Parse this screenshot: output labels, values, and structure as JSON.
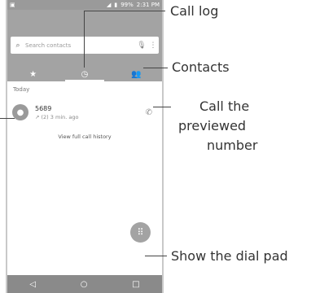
{
  "status": {
    "left_icon": "sim-icon",
    "battery": "99%",
    "time": "2:31 PM"
  },
  "search": {
    "placeholder": "Search contacts"
  },
  "tabs": [
    {
      "name": "tab-favorites",
      "glyph": "★"
    },
    {
      "name": "tab-call-log",
      "glyph": "◷"
    },
    {
      "name": "tab-contacts",
      "glyph": "👥"
    }
  ],
  "section_header": "Today",
  "call": {
    "number": "5689",
    "detail": "(2) 3 min. ago"
  },
  "full_history": "View full call history",
  "annotations": {
    "call_log": "Call log",
    "contacts": "Contacts",
    "call_previewed_1": "Call the",
    "call_previewed_2": "previewed",
    "call_previewed_3": "number",
    "dial_pad": "Show the dial pad"
  }
}
